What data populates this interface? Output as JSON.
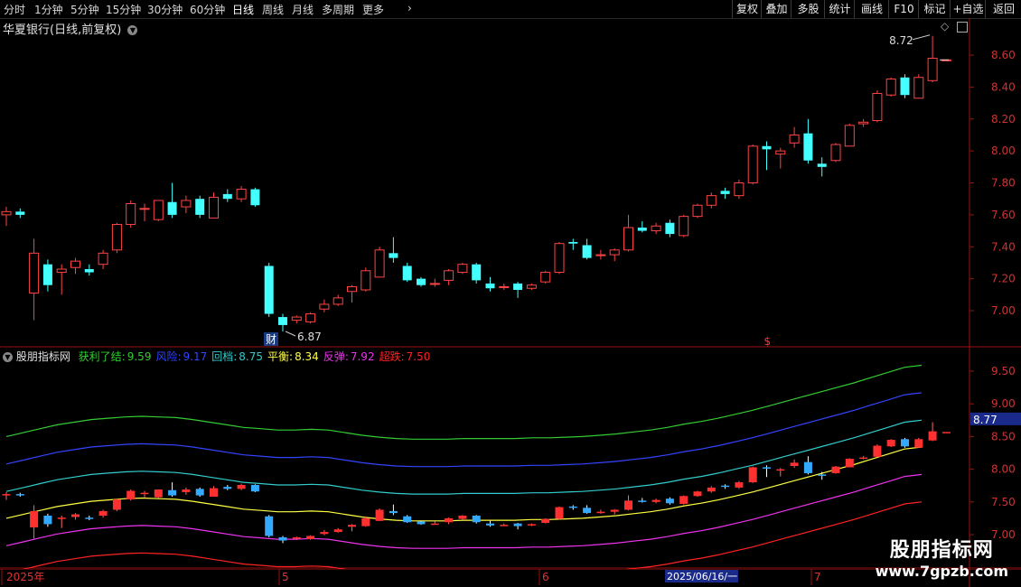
{
  "toolbar": {
    "periods": [
      "分时",
      "1分钟",
      "5分钟",
      "15分钟",
      "30分钟",
      "60分钟",
      "日线",
      "周线",
      "月线",
      "多周期",
      "更多"
    ],
    "active_period": "日线",
    "right_buttons": [
      "复权",
      "叠加",
      "多股",
      "统计",
      "画线",
      "F10",
      "标记",
      "+自选",
      "返回"
    ]
  },
  "main": {
    "stock_title": "华夏银行(日线,前复权)",
    "high_label": "8.72",
    "low_label": "6.87",
    "cai_label": "财",
    "dollar_mark": "$",
    "price_ticks": [
      "8.60",
      "8.40",
      "8.20",
      "8.00",
      "7.80",
      "7.60",
      "7.40",
      "7.20",
      "7.00"
    ]
  },
  "indicator": {
    "name": "股朋指标网",
    "lines": [
      {
        "label": "获利了结",
        "value": "9.59",
        "color": "#33cc33"
      },
      {
        "label": "风险",
        "value": "9.17",
        "color": "#3344ff"
      },
      {
        "label": "回档",
        "value": "8.75",
        "color": "#33cccc"
      },
      {
        "label": "平衡",
        "value": "8.34",
        "color": "#ffff44"
      },
      {
        "label": "反弹",
        "value": "7.92",
        "color": "#ee33ee"
      },
      {
        "label": "超跌",
        "value": "7.50",
        "color": "#ff2222"
      }
    ],
    "ticks": [
      "9.50",
      "9.00",
      "8.50",
      "8.00",
      "7.50",
      "7.00"
    ],
    "current_price": "8.77"
  },
  "date_axis": {
    "labels": [
      "2025年",
      "5",
      "6",
      "7"
    ],
    "cursor_date": "2025/06/16/一"
  },
  "watermark": {
    "line1": "股朋指标网",
    "line2": "www.7gpzb.com"
  },
  "colors": {
    "up": "#ff4444",
    "down": "#44ffff",
    "axis": "#9a1010"
  },
  "candles": [
    [
      7.6,
      7.62,
      7.65,
      7.53
    ],
    [
      7.62,
      7.6,
      7.64,
      7.58
    ],
    [
      7.11,
      7.36,
      7.45,
      6.94
    ],
    [
      7.29,
      7.16,
      7.32,
      7.12
    ],
    [
      7.24,
      7.26,
      7.29,
      7.1
    ],
    [
      7.27,
      7.31,
      7.33,
      7.23
    ],
    [
      7.26,
      7.24,
      7.29,
      7.22
    ],
    [
      7.29,
      7.36,
      7.38,
      7.26
    ],
    [
      7.38,
      7.54,
      7.55,
      7.36
    ],
    [
      7.54,
      7.67,
      7.69,
      7.52
    ],
    [
      7.64,
      7.64,
      7.67,
      7.56
    ],
    [
      7.57,
      7.69,
      7.69,
      7.56
    ],
    [
      7.68,
      7.6,
      7.8,
      7.58
    ],
    [
      7.65,
      7.69,
      7.72,
      7.61
    ],
    [
      7.7,
      7.6,
      7.72,
      7.58
    ],
    [
      7.58,
      7.71,
      7.74,
      7.58
    ],
    [
      7.73,
      7.7,
      7.76,
      7.68
    ],
    [
      7.7,
      7.76,
      7.78,
      7.68
    ],
    [
      7.76,
      7.66,
      7.77,
      7.65
    ],
    [
      7.28,
      6.98,
      7.3,
      6.96
    ],
    [
      6.96,
      6.91,
      6.98,
      6.87
    ],
    [
      6.94,
      6.96,
      6.97,
      6.92
    ],
    [
      6.93,
      6.98,
      6.99,
      6.92
    ],
    [
      7.01,
      7.04,
      7.07,
      6.99
    ],
    [
      7.04,
      7.08,
      7.1,
      7.03
    ],
    [
      7.12,
      7.15,
      7.16,
      7.05
    ],
    [
      7.13,
      7.25,
      7.27,
      7.12
    ],
    [
      7.21,
      7.38,
      7.4,
      7.21
    ],
    [
      7.36,
      7.33,
      7.46,
      7.3
    ],
    [
      7.28,
      7.19,
      7.3,
      7.18
    ],
    [
      7.2,
      7.16,
      7.21,
      7.15
    ],
    [
      7.17,
      7.17,
      7.2,
      7.15
    ],
    [
      7.19,
      7.25,
      7.26,
      7.16
    ],
    [
      7.24,
      7.29,
      7.3,
      7.23
    ],
    [
      7.29,
      7.19,
      7.3,
      7.17
    ],
    [
      7.17,
      7.14,
      7.21,
      7.12
    ],
    [
      7.15,
      7.15,
      7.17,
      7.13
    ],
    [
      7.17,
      7.13,
      7.18,
      7.08
    ],
    [
      7.14,
      7.16,
      7.17,
      7.13
    ],
    [
      7.18,
      7.24,
      7.25,
      7.17
    ],
    [
      7.24,
      7.42,
      7.43,
      7.23
    ],
    [
      7.43,
      7.42,
      7.45,
      7.38
    ],
    [
      7.41,
      7.33,
      7.45,
      7.32
    ],
    [
      7.35,
      7.35,
      7.38,
      7.32
    ],
    [
      7.35,
      7.38,
      7.39,
      7.31
    ],
    [
      7.38,
      7.52,
      7.6,
      7.37
    ],
    [
      7.52,
      7.5,
      7.56,
      7.49
    ],
    [
      7.5,
      7.53,
      7.55,
      7.48
    ],
    [
      7.55,
      7.48,
      7.57,
      7.46
    ],
    [
      7.47,
      7.59,
      7.6,
      7.46
    ],
    [
      7.59,
      7.66,
      7.67,
      7.58
    ],
    [
      7.66,
      7.72,
      7.74,
      7.64
    ],
    [
      7.75,
      7.73,
      7.77,
      7.7
    ],
    [
      7.72,
      7.8,
      7.82,
      7.7
    ],
    [
      7.8,
      8.03,
      8.04,
      7.79
    ],
    [
      8.03,
      8.01,
      8.06,
      7.88
    ],
    [
      7.98,
      8.0,
      8.02,
      7.89
    ],
    [
      8.05,
      8.1,
      8.15,
      8.02
    ],
    [
      8.11,
      7.94,
      8.2,
      7.92
    ],
    [
      7.92,
      7.9,
      7.96,
      7.84
    ],
    [
      7.94,
      8.04,
      8.05,
      7.93
    ],
    [
      8.03,
      8.16,
      8.17,
      8.03
    ],
    [
      8.17,
      8.18,
      8.2,
      8.15
    ],
    [
      8.19,
      8.36,
      8.38,
      8.18
    ],
    [
      8.35,
      8.45,
      8.46,
      8.34
    ],
    [
      8.46,
      8.35,
      8.48,
      8.33
    ],
    [
      8.33,
      8.46,
      8.48,
      8.33
    ],
    [
      8.44,
      8.58,
      8.72,
      8.43
    ],
    [
      8.57,
      8.57,
      8.57,
      8.57
    ]
  ],
  "bands": {
    "profit": [
      8.5,
      8.56,
      8.62,
      8.68,
      8.72,
      8.76,
      8.78,
      8.8,
      8.81,
      8.8,
      8.79,
      8.76,
      8.72,
      8.68,
      8.64,
      8.62,
      8.6,
      8.6,
      8.61,
      8.6,
      8.56,
      8.52,
      8.49,
      8.47,
      8.46,
      8.46,
      8.46,
      8.47,
      8.47,
      8.47,
      8.47,
      8.48,
      8.48,
      8.49,
      8.5,
      8.52,
      8.54,
      8.57,
      8.6,
      8.64,
      8.69,
      8.73,
      8.78,
      8.84,
      8.9,
      8.97,
      9.04,
      9.11,
      9.18,
      9.25,
      9.32,
      9.4,
      9.48,
      9.56,
      9.59
    ],
    "risk": [
      8.08,
      8.14,
      8.2,
      8.26,
      8.3,
      8.34,
      8.36,
      8.38,
      8.39,
      8.38,
      8.37,
      8.34,
      8.3,
      8.26,
      8.22,
      8.2,
      8.18,
      8.18,
      8.19,
      8.18,
      8.14,
      8.1,
      8.07,
      8.05,
      8.04,
      8.04,
      8.04,
      8.05,
      8.05,
      8.05,
      8.05,
      8.06,
      8.06,
      8.07,
      8.08,
      8.1,
      8.12,
      8.15,
      8.18,
      8.22,
      8.27,
      8.31,
      8.36,
      8.42,
      8.48,
      8.55,
      8.62,
      8.69,
      8.76,
      8.83,
      8.9,
      8.98,
      9.06,
      9.14,
      9.17
    ],
    "retrace": [
      7.66,
      7.72,
      7.78,
      7.84,
      7.88,
      7.92,
      7.94,
      7.96,
      7.97,
      7.96,
      7.95,
      7.92,
      7.88,
      7.84,
      7.8,
      7.78,
      7.76,
      7.76,
      7.77,
      7.76,
      7.72,
      7.68,
      7.65,
      7.63,
      7.62,
      7.62,
      7.62,
      7.63,
      7.63,
      7.63,
      7.63,
      7.64,
      7.64,
      7.65,
      7.66,
      7.68,
      7.7,
      7.73,
      7.76,
      7.8,
      7.85,
      7.89,
      7.94,
      8.0,
      8.06,
      8.13,
      8.2,
      8.27,
      8.34,
      8.41,
      8.48,
      8.56,
      8.64,
      8.72,
      8.75
    ],
    "balance": [
      7.25,
      7.31,
      7.37,
      7.43,
      7.47,
      7.51,
      7.53,
      7.55,
      7.56,
      7.55,
      7.54,
      7.51,
      7.47,
      7.43,
      7.39,
      7.37,
      7.35,
      7.35,
      7.36,
      7.35,
      7.31,
      7.27,
      7.24,
      7.22,
      7.21,
      7.21,
      7.21,
      7.22,
      7.22,
      7.22,
      7.22,
      7.23,
      7.23,
      7.24,
      7.25,
      7.27,
      7.29,
      7.32,
      7.35,
      7.39,
      7.44,
      7.48,
      7.53,
      7.59,
      7.65,
      7.72,
      7.79,
      7.86,
      7.93,
      8.0,
      8.07,
      8.15,
      8.23,
      8.31,
      8.34
    ],
    "rebound": [
      6.83,
      6.89,
      6.95,
      7.01,
      7.05,
      7.09,
      7.11,
      7.13,
      7.14,
      7.13,
      7.12,
      7.09,
      7.05,
      7.01,
      6.97,
      6.95,
      6.93,
      6.93,
      6.94,
      6.93,
      6.89,
      6.85,
      6.82,
      6.8,
      6.79,
      6.79,
      6.79,
      6.8,
      6.8,
      6.8,
      6.8,
      6.81,
      6.81,
      6.82,
      6.83,
      6.85,
      6.87,
      6.9,
      6.93,
      6.97,
      7.02,
      7.06,
      7.11,
      7.17,
      7.23,
      7.3,
      7.37,
      7.44,
      7.51,
      7.58,
      7.65,
      7.73,
      7.81,
      7.89,
      7.92
    ],
    "oversold": [
      6.41,
      6.47,
      6.53,
      6.59,
      6.63,
      6.67,
      6.69,
      6.71,
      6.72,
      6.71,
      6.7,
      6.67,
      6.63,
      6.59,
      6.55,
      6.53,
      6.51,
      6.51,
      6.52,
      6.51,
      6.47,
      6.43,
      6.4,
      6.38,
      6.37,
      6.37,
      6.37,
      6.38,
      6.38,
      6.38,
      6.38,
      6.39,
      6.39,
      6.4,
      6.41,
      6.43,
      6.45,
      6.48,
      6.51,
      6.55,
      6.6,
      6.64,
      6.69,
      6.75,
      6.81,
      6.88,
      6.95,
      7.02,
      7.09,
      7.16,
      7.23,
      7.31,
      7.39,
      7.47,
      7.5
    ]
  }
}
